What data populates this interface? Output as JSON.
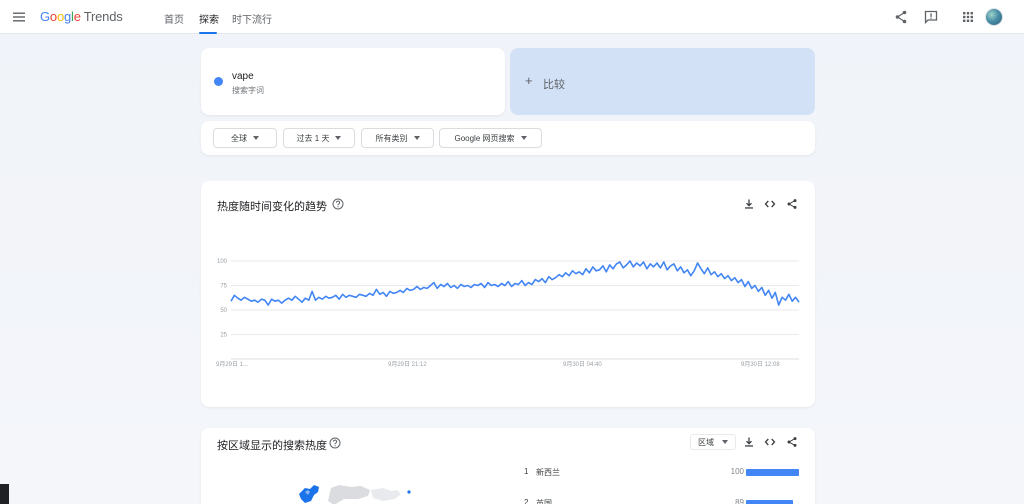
{
  "header": {
    "logo": {
      "g1": "G",
      "o1": "o",
      "o2": "o",
      "g2": "g",
      "l": "l",
      "e": "e",
      "trends": "Trends"
    },
    "tabs": [
      "首页",
      "探索",
      "时下流行"
    ],
    "active_tab": 1,
    "icons": [
      "menu-icon",
      "share-icon",
      "feedback-icon",
      "apps-icon",
      "avatar"
    ]
  },
  "search": {
    "term": "vape",
    "term_type": "搜索字词",
    "term_color": "#4285f4",
    "compare_label": "比较"
  },
  "filters": [
    "全球",
    "过去 1 天",
    "所有类别",
    "Google 网页搜索"
  ],
  "interest_over_time": {
    "title": "热度随时间变化的趋势"
  },
  "chart_data": {
    "type": "line",
    "title": "",
    "xlabel": "",
    "ylabel": "",
    "ylim": [
      0,
      100
    ],
    "yticks": [
      25,
      50,
      75,
      100
    ],
    "x_tick_labels": [
      "9月29日 1...",
      "9月29日 21:12",
      "9月30日 04:40",
      "9月30日 12:08"
    ],
    "grid": true,
    "color": "#4285f4",
    "series": [
      {
        "values": [
          59,
          65,
          62,
          60,
          63,
          61,
          59,
          60,
          58,
          61,
          60,
          55,
          61,
          59,
          60,
          57,
          60,
          62,
          60,
          64,
          61,
          58,
          62,
          60,
          69,
          60,
          63,
          61,
          64,
          62,
          63,
          65,
          61,
          66,
          63,
          65,
          64,
          63,
          66,
          65,
          64,
          67,
          65,
          71,
          66,
          68,
          64,
          69,
          67,
          68,
          70,
          68,
          72,
          70,
          71,
          74,
          71,
          73,
          72,
          75,
          78,
          72,
          76,
          74,
          77,
          73,
          75,
          72,
          76,
          74,
          75,
          73,
          76,
          75,
          77,
          73,
          78,
          75,
          76,
          74,
          77,
          75,
          79,
          74,
          77,
          76,
          80,
          75,
          78,
          76,
          81,
          79,
          82,
          78,
          84,
          81,
          83,
          86,
          84,
          88,
          85,
          90,
          87,
          89,
          86,
          92,
          88,
          94,
          90,
          91,
          95,
          89,
          96,
          92,
          97,
          99,
          93,
          96,
          100,
          94,
          98,
          95,
          99,
          92,
          97,
          94,
          98,
          93,
          99,
          91,
          95,
          97,
          90,
          94,
          88,
          91,
          85,
          90,
          98,
          92,
          87,
          93,
          86,
          89,
          84,
          87,
          82,
          85,
          80,
          83,
          78,
          81,
          74,
          79,
          72,
          75,
          69,
          73,
          65,
          70,
          62,
          68,
          55,
          63,
          60,
          66,
          59,
          63,
          58
        ]
      }
    ]
  },
  "region": {
    "title": "按区域显示的搜索热度",
    "select": "区域",
    "rows": [
      {
        "rank": "1",
        "name": "新西兰",
        "value": "100",
        "fill": 1.0
      },
      {
        "rank": "2",
        "name": "英国",
        "value": "89",
        "fill": 0.89
      }
    ]
  }
}
